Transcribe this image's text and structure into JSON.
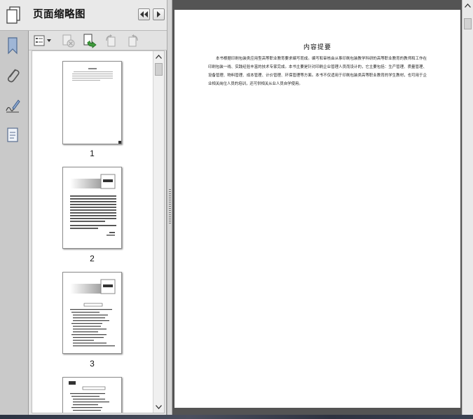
{
  "panel": {
    "title": "页面缩略图",
    "collapse_label": "◀◀",
    "expand_label": "▶"
  },
  "rail": {
    "items": [
      {
        "icon": "pages-icon"
      },
      {
        "icon": "bookmark-icon"
      },
      {
        "icon": "attachment-icon"
      },
      {
        "icon": "signature-icon"
      },
      {
        "icon": "layers-icon"
      }
    ]
  },
  "toolbar": {
    "options_icon": "thumbnail-options-icon",
    "disabled_icons": [
      "delete-pages-icon",
      "rotate-left-icon",
      "rotate-right-icon"
    ],
    "active_icon": "extract-pages-icon"
  },
  "thumbnails": [
    {
      "page_label": "1"
    },
    {
      "page_label": "2"
    },
    {
      "page_label": "3"
    },
    {
      "page_label": ""
    }
  ],
  "document": {
    "heading": "内容提要",
    "body": "本书根据印刷包装类应用型高等职业教育要求编写而成。编写和审核由从事印刷包装教学科研的高等职业教育的教师和工作在印刷包装一线、实践经验丰富的技术专家完成。本书主要是针对印刷企业管理人员而设计的，它主要包括：生产管理、质量管理、设备管理、物料管理、成本管理、计价管理、环保管理等方面。本书不仅适用于印刷包装类高等职业教育的学生教材，也可用于企业相关岗位人员的培训，还可供相关从业人员自学使用。"
  },
  "colors": {
    "panel_bg": "#e4e4e4",
    "doc_bg": "#545454",
    "rail_bg": "#c9c9c9"
  }
}
